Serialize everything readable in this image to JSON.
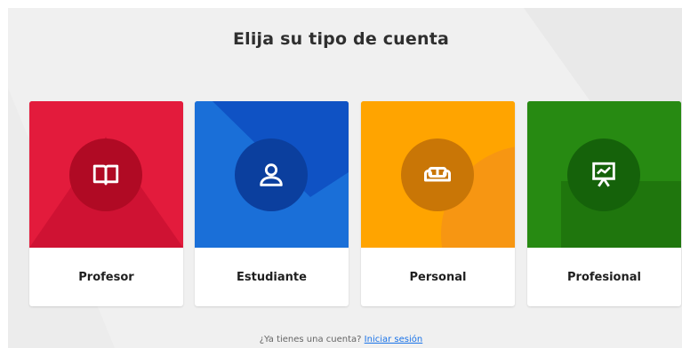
{
  "page": {
    "title": "Elija su tipo de cuenta"
  },
  "cards": [
    {
      "label": "Profesor",
      "icon": "book-icon",
      "color": "#e31b3c",
      "circle": "#b00a24"
    },
    {
      "label": "Estudiante",
      "icon": "user-icon",
      "color": "#1664d1",
      "circle": "#0b3f9e"
    },
    {
      "label": "Personal",
      "icon": "sofa-icon",
      "color": "#ffa400",
      "circle": "#c97606"
    },
    {
      "label": "Profesional",
      "icon": "presentation-icon",
      "color": "#278a12",
      "circle": "#15620a"
    }
  ],
  "footer": {
    "question": "¿Ya tienes una cuenta?",
    "login_link": "Iniciar sesión"
  }
}
